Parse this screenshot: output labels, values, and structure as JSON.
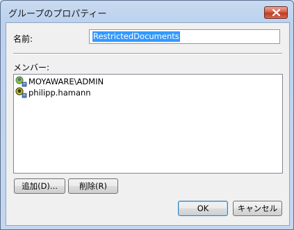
{
  "window": {
    "title": "グループのプロパティー"
  },
  "form": {
    "name_label": "名前:",
    "name_value": "RestrictedDocuments",
    "members_label": "メンバー:"
  },
  "members": [
    {
      "name": "MOYAWARE\\ADMIN",
      "icon": "user-icon"
    },
    {
      "name": "philipp.hamann",
      "icon": "user-icon"
    }
  ],
  "buttons": {
    "add": "追加(D)...",
    "remove": "削除(R)",
    "ok": "OK",
    "cancel": "キャンセル"
  }
}
